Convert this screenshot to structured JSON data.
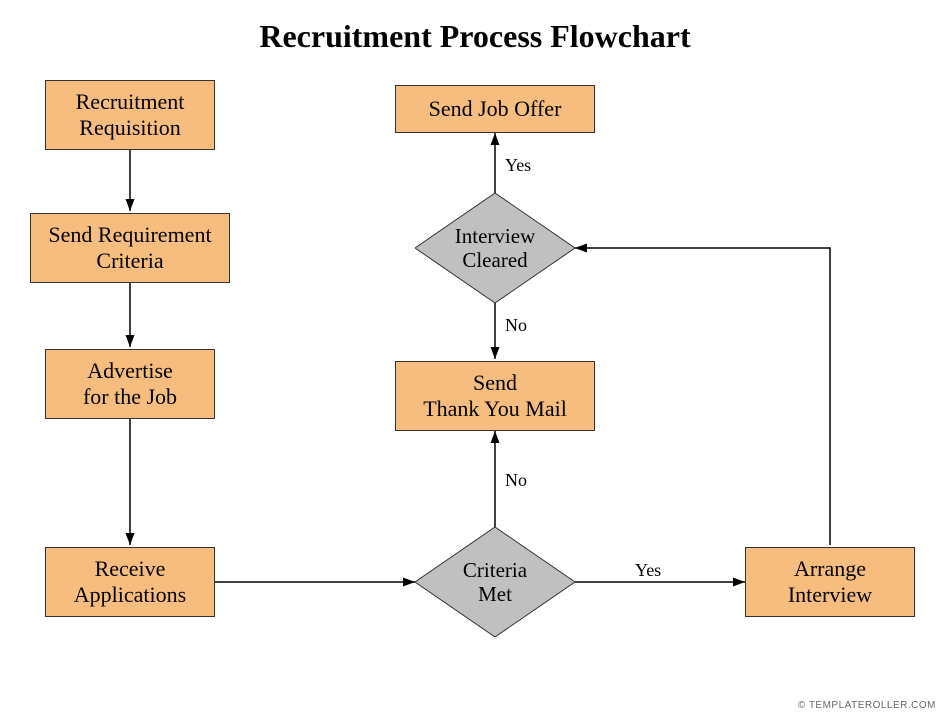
{
  "title": "Recruitment Process Flowchart",
  "nodes": {
    "recruitment_requisition": "Recruitment\nRequisition",
    "send_requirement_criteria": "Send Requirement\nCriteria",
    "advertise_job": "Advertise\nfor the Job",
    "receive_applications": "Receive\nApplications",
    "criteria_met": "Criteria\nMet",
    "arrange_interview": "Arrange\nInterview",
    "interview_cleared": "Interview\nCleared",
    "send_thank_you": "Send\nThank You Mail",
    "send_job_offer": "Send Job Offer"
  },
  "edges": {
    "yes1": "Yes",
    "no1": "No",
    "yes2": "Yes",
    "no2": "No"
  },
  "footer": "© TEMPLATEROLLER.COM",
  "chart_data": {
    "type": "flowchart",
    "title": "Recruitment Process Flowchart",
    "nodes": [
      {
        "id": "recruitment_requisition",
        "shape": "process",
        "label": "Recruitment Requisition"
      },
      {
        "id": "send_requirement_criteria",
        "shape": "process",
        "label": "Send Requirement Criteria"
      },
      {
        "id": "advertise_job",
        "shape": "process",
        "label": "Advertise for the Job"
      },
      {
        "id": "receive_applications",
        "shape": "process",
        "label": "Receive Applications"
      },
      {
        "id": "criteria_met",
        "shape": "decision",
        "label": "Criteria Met"
      },
      {
        "id": "arrange_interview",
        "shape": "process",
        "label": "Arrange Interview"
      },
      {
        "id": "interview_cleared",
        "shape": "decision",
        "label": "Interview Cleared"
      },
      {
        "id": "send_thank_you",
        "shape": "process",
        "label": "Send Thank You Mail"
      },
      {
        "id": "send_job_offer",
        "shape": "process",
        "label": "Send Job Offer"
      }
    ],
    "edges": [
      {
        "from": "recruitment_requisition",
        "to": "send_requirement_criteria"
      },
      {
        "from": "send_requirement_criteria",
        "to": "advertise_job"
      },
      {
        "from": "advertise_job",
        "to": "receive_applications"
      },
      {
        "from": "receive_applications",
        "to": "criteria_met"
      },
      {
        "from": "criteria_met",
        "to": "arrange_interview",
        "label": "Yes"
      },
      {
        "from": "criteria_met",
        "to": "send_thank_you",
        "label": "No"
      },
      {
        "from": "arrange_interview",
        "to": "interview_cleared"
      },
      {
        "from": "interview_cleared",
        "to": "send_job_offer",
        "label": "Yes"
      },
      {
        "from": "interview_cleared",
        "to": "send_thank_you",
        "label": "No"
      }
    ]
  }
}
